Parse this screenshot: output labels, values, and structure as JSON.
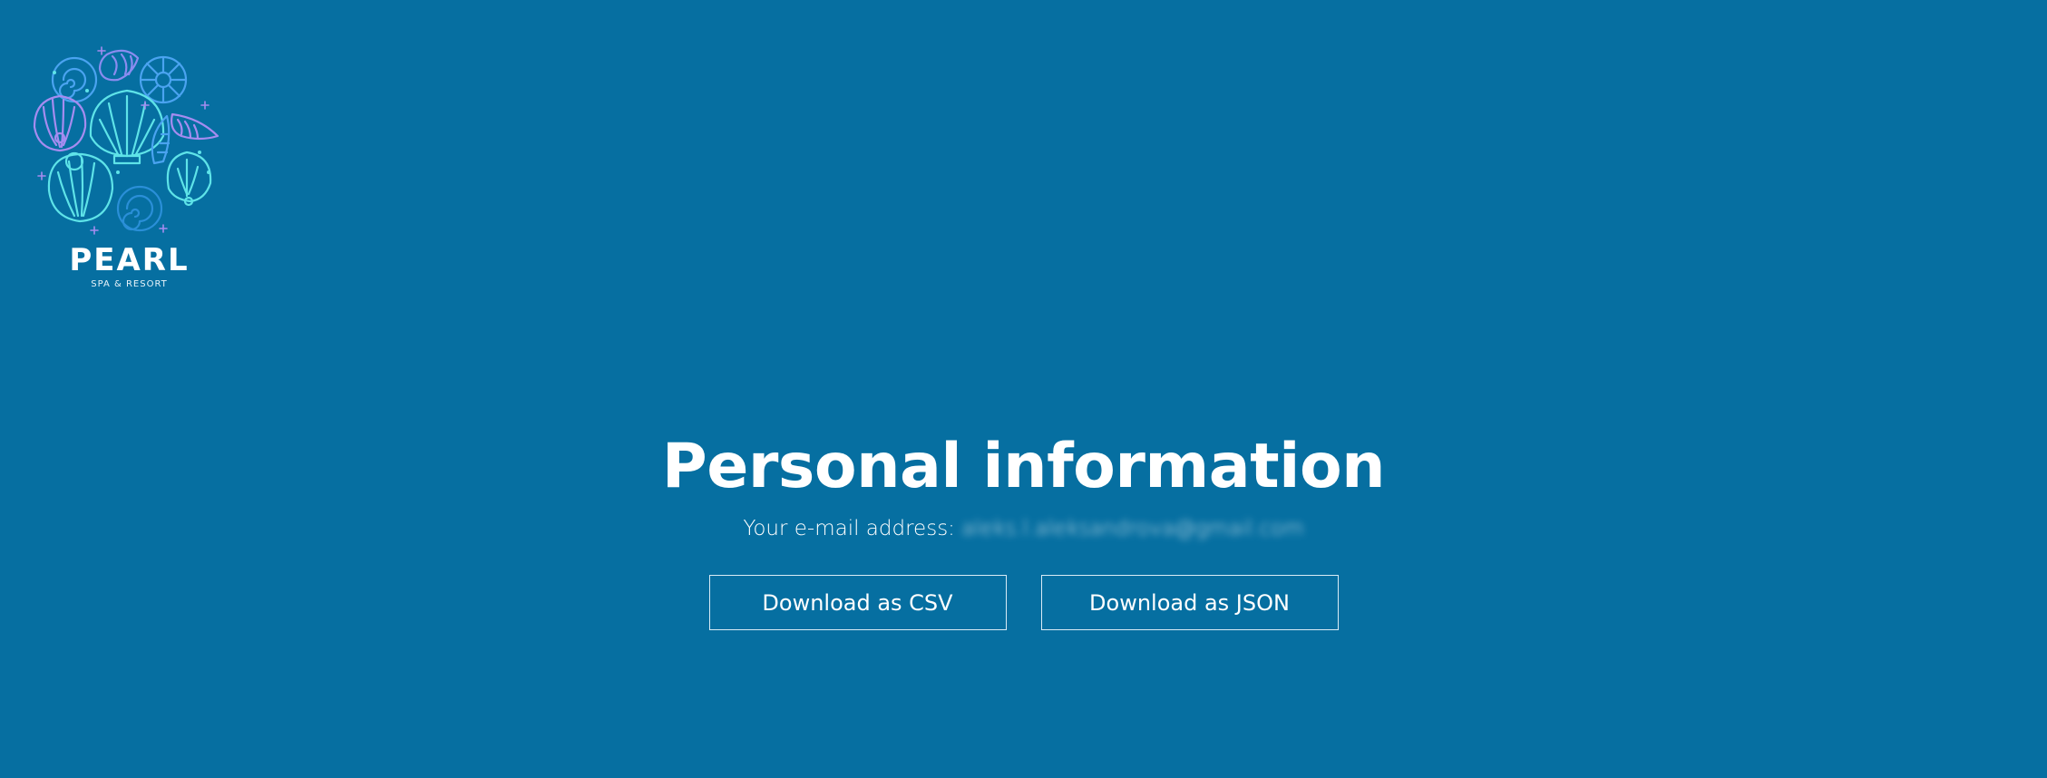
{
  "brand": {
    "name": "PEARL",
    "tagline": "SPA & RESORT"
  },
  "main": {
    "title": "Personal information",
    "email_label": "Your e-mail address:",
    "email_value": "aleks.l.aleksandrova@gmail.com",
    "buttons": {
      "csv_label": "Download as CSV",
      "json_label": "Download as JSON"
    }
  },
  "colors": {
    "background": "#066fa1",
    "text": "#ffffff",
    "logo_cyan": "#5ee3e8",
    "logo_blue": "#4aa3f0",
    "logo_violet": "#a58cf0"
  }
}
